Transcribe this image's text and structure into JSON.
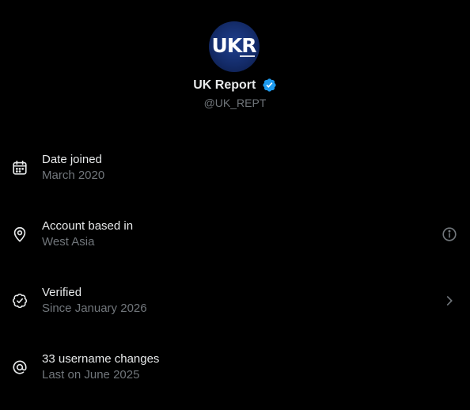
{
  "profile": {
    "avatar_text_main": "UK",
    "avatar_text_accent": "R",
    "display_name": "UK Report",
    "handle": "@UK_REPT",
    "verified_badge_color": "#1d9bf0"
  },
  "info_rows": [
    {
      "icon": "calendar-icon",
      "title": "Date joined",
      "subtitle": "March 2020",
      "action_icon": null
    },
    {
      "icon": "location-pin-icon",
      "title": "Account based in",
      "subtitle": "West Asia",
      "action_icon": "info-icon"
    },
    {
      "icon": "verified-check-icon",
      "title": "Verified",
      "subtitle": "Since January 2026",
      "action_icon": "chevron-right-icon"
    },
    {
      "icon": "at-sign-icon",
      "title": "33 username changes",
      "subtitle": "Last on June 2025",
      "action_icon": null
    }
  ],
  "colors": {
    "background": "#000000",
    "primary_text": "#e7e9ea",
    "secondary_text": "#71767b",
    "accent": "#1d9bf0"
  }
}
